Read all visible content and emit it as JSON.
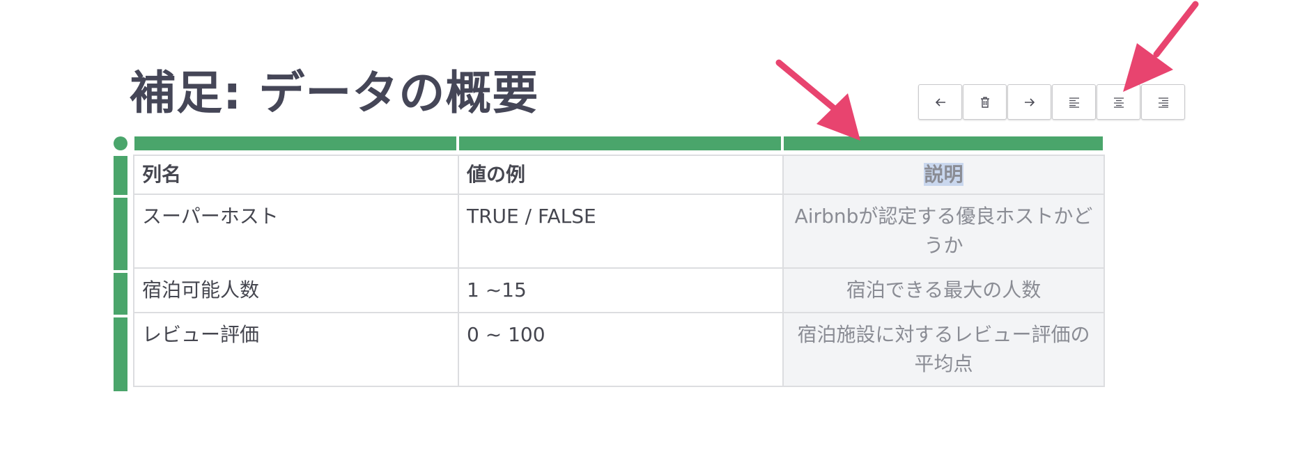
{
  "title": "補足: データの概要",
  "toolbar": {
    "buttons": [
      {
        "icon": "arrow-left-icon"
      },
      {
        "icon": "trash-icon"
      },
      {
        "icon": "arrow-right-icon"
      },
      {
        "icon": "align-left-icon"
      },
      {
        "icon": "align-center-icon"
      },
      {
        "icon": "align-right-icon"
      }
    ]
  },
  "table": {
    "headers": [
      "列名",
      "値の例",
      "説明"
    ],
    "rows": [
      [
        "スーパーホスト",
        "TRUE / FALSE",
        "Airbnbが認定する優良ホストかどうか"
      ],
      [
        "宿泊可能人数",
        "1 ~15",
        "宿泊できる最大の人数"
      ],
      [
        "レビュー評価",
        "0 ~ 100",
        "宿泊施設に対するレビュー評価の平均点"
      ]
    ]
  },
  "colors": {
    "accent_green": "#4aa56b",
    "annotation_arrow": "#e8446f",
    "title_text": "#454657",
    "selection": "#c9d7ee"
  }
}
